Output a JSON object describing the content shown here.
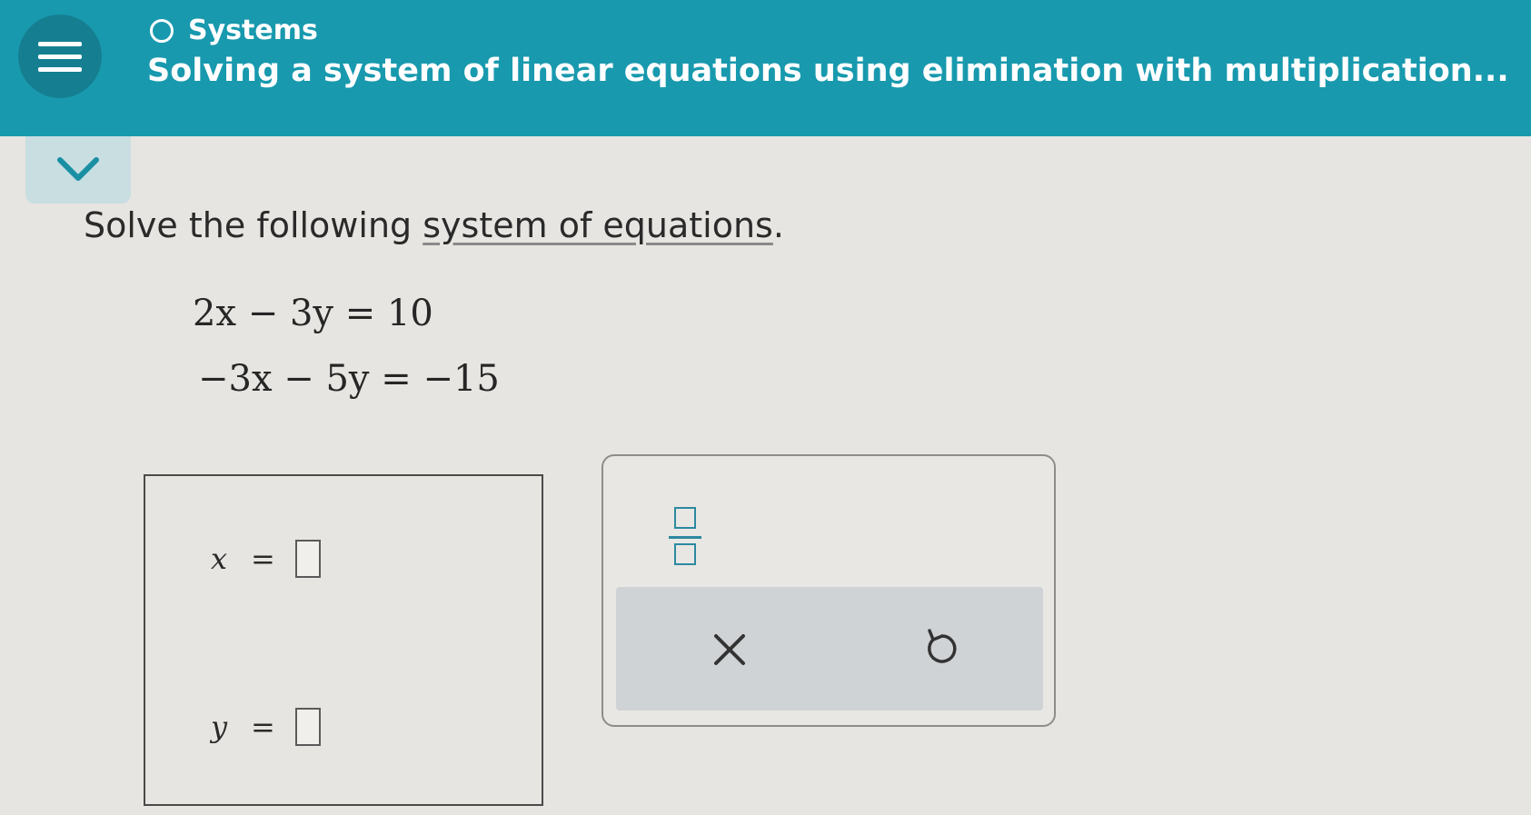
{
  "header": {
    "topic": "Systems",
    "lesson_title": "Solving a system of linear equations using elimination with multiplication..."
  },
  "prompt": {
    "lead": "Solve the following ",
    "link_text": "system of equations",
    "end": "."
  },
  "equations": [
    "2x − 3y = 10",
    "−3x − 5y = −15"
  ],
  "answers": [
    {
      "variable": "x",
      "equals": "=",
      "value": ""
    },
    {
      "variable": "y",
      "equals": "=",
      "value": ""
    }
  ],
  "icons": {
    "menu": "menu-icon",
    "topic": "circle-outline-icon",
    "collapse": "chevron-down-icon",
    "fraction": "fraction-icon",
    "clear": "x-icon",
    "undo": "undo-icon"
  },
  "colors": {
    "header_bg": "#1899ae",
    "accent": "#2c89a0"
  }
}
